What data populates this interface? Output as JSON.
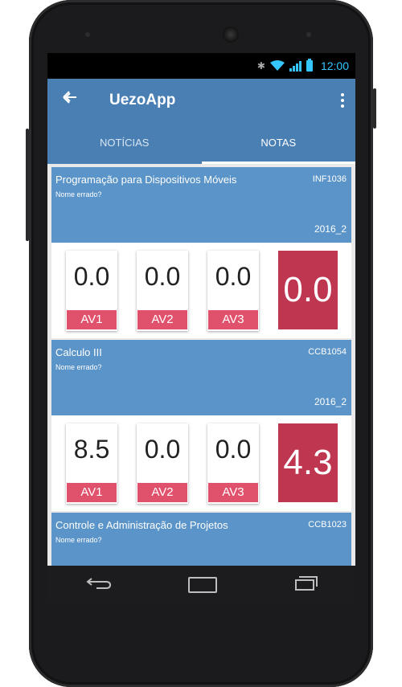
{
  "statusbar": {
    "time": "12:00"
  },
  "app": {
    "title": "UezoApp"
  },
  "tabs": [
    {
      "label": "NOTÍCIAS"
    },
    {
      "label": "NOTAS"
    }
  ],
  "courses": [
    {
      "name": "Programação para Dispositivos Móveis",
      "code": "INF1036",
      "note": "Nome errado?",
      "semester": "2016_2",
      "grades": [
        {
          "value": "0.0",
          "label": "AV1"
        },
        {
          "value": "0.0",
          "label": "AV2"
        },
        {
          "value": "0.0",
          "label": "AV3"
        }
      ],
      "final": "0.0"
    },
    {
      "name": "Calculo III",
      "code": "CCB1054",
      "note": "Nome errado?",
      "semester": "2016_2",
      "grades": [
        {
          "value": "8.5",
          "label": "AV1"
        },
        {
          "value": "0.0",
          "label": "AV2"
        },
        {
          "value": "0.0",
          "label": "AV3"
        }
      ],
      "final": "4.3"
    },
    {
      "name": "Controle e Administração de Projetos",
      "code": "CCB1023",
      "note": "Nome errado?"
    }
  ],
  "icons": {
    "back": "arrow-left-icon",
    "more": "more-vert-icon",
    "nav_back": "back-icon",
    "nav_home": "home-icon",
    "nav_recents": "recents-icon"
  },
  "colors": {
    "appbar": "#4a7fb4",
    "card_header": "#5b94c8",
    "grade_label": "#e0516b",
    "final_grade": "#bf3651"
  }
}
